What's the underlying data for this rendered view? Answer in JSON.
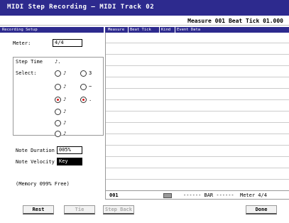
{
  "title": "MIDI Step Recording — MIDI Track 02",
  "measure_readout": "Measure 001  Beat Tick  01.000",
  "left_header": "Recording Setup",
  "table_headers": [
    "Measure",
    "Beat Tick",
    "Kind",
    "Event Data"
  ],
  "meter": {
    "label": "Meter:",
    "value": "4/4"
  },
  "step_time_label": "Step Time",
  "step_time_current": "♪.",
  "select_label": "Select:",
  "radios": [
    {
      "label": "♪",
      "checked": false
    },
    {
      "label": "3",
      "checked": false
    },
    {
      "label": "♪",
      "checked": false
    },
    {
      "label": "~",
      "checked": false
    },
    {
      "label": "♪",
      "checked": true
    },
    {
      "label": ".",
      "checked": true
    },
    {
      "label": "♪",
      "checked": false
    },
    {
      "label": "♪",
      "checked": false
    },
    {
      "label": "♪",
      "checked": false
    }
  ],
  "note_duration": {
    "label": "Note Duration",
    "value": "005%"
  },
  "note_velocity": {
    "label": "Note Velocity",
    "value": "Key"
  },
  "memory": "(Memory 099% Free)",
  "bottom_row": {
    "measure": "001",
    "bar": "------ BAR ------",
    "meter": "Meter  4/4"
  },
  "buttons": {
    "rest": "Rest",
    "tie": "Tie",
    "stepback": "Step Back",
    "done": "Done"
  }
}
